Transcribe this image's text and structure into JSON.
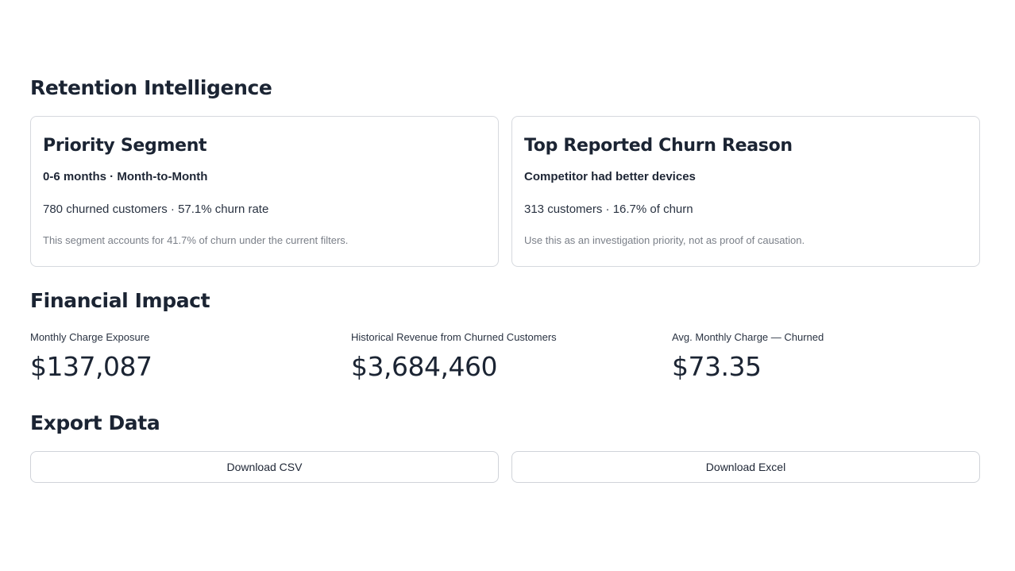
{
  "sections": {
    "retention_title": "Retention Intelligence",
    "financial_title": "Financial Impact",
    "export_title": "Export Data"
  },
  "cards": [
    {
      "title": "Priority Segment",
      "highlight": "0-6 months · Month-to-Month",
      "stats": "780 churned customers · 57.1% churn rate",
      "note": "This segment accounts for 41.7% of churn under the current filters."
    },
    {
      "title": "Top Reported Churn Reason",
      "highlight": "Competitor had better devices",
      "stats": "313 customers · 16.7% of churn",
      "note": "Use this as an investigation priority, not as proof of causation."
    }
  ],
  "metrics": [
    {
      "label": "Monthly Charge Exposure",
      "value": "$137,087"
    },
    {
      "label": "Historical Revenue from Churned Customers",
      "value": "$3,684,460"
    },
    {
      "label": "Avg. Monthly Charge — Churned",
      "value": "$73.35"
    }
  ],
  "export": {
    "csv_label": "Download CSV",
    "excel_label": "Download Excel"
  }
}
